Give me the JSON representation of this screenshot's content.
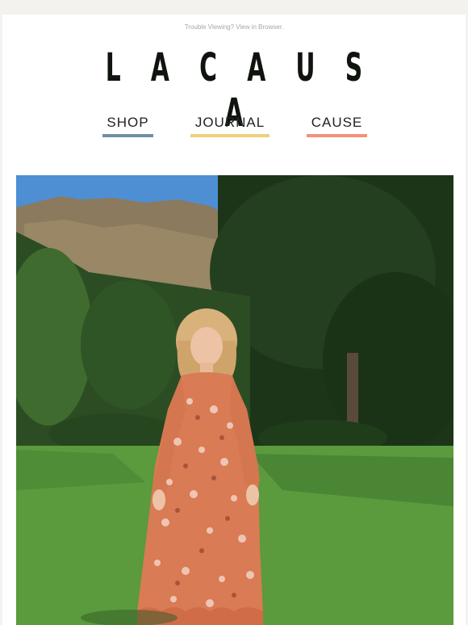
{
  "header": {
    "trouble_text": "Trouble Viewing? View in Browser.",
    "brand_letters": [
      "L",
      "A",
      "C",
      "A",
      "U",
      "S",
      "A"
    ]
  },
  "nav": {
    "items": [
      {
        "label": "SHOP",
        "color": "#6f8fa2"
      },
      {
        "label": "JOURNAL",
        "color": "#ecd07c"
      },
      {
        "label": "CAUSE",
        "color": "#f4907a"
      }
    ]
  },
  "hero": {
    "image_label": "",
    "colors": {
      "sky": "#4e8fd3",
      "grass": "#5b9a3d",
      "trees": "#1d3a1a",
      "dress": "#d97b54"
    }
  }
}
